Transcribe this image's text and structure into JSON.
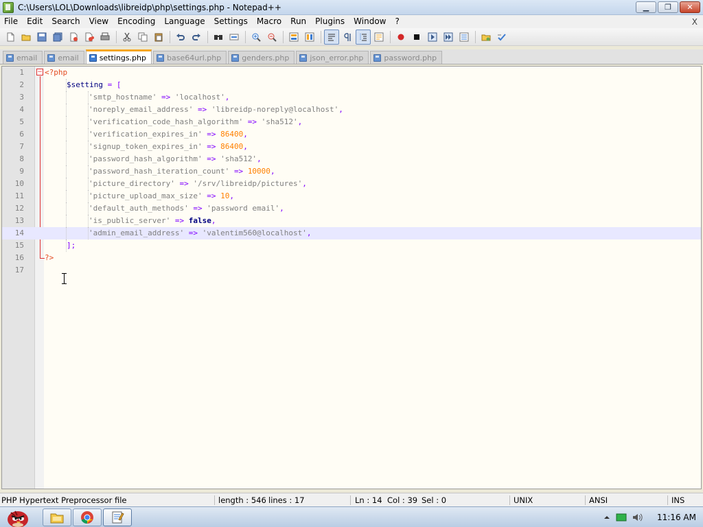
{
  "window": {
    "title": "C:\\Users\\LOL\\Downloads\\libreidp\\php\\settings.php - Notepad++",
    "minimize_glyph": "▁",
    "maximize_glyph": "❐",
    "close_glyph": "✕"
  },
  "menu": {
    "items": [
      "File",
      "Edit",
      "Search",
      "View",
      "Encoding",
      "Language",
      "Settings",
      "Macro",
      "Run",
      "Plugins",
      "Window",
      "?"
    ],
    "close_label": "X"
  },
  "toolbar": {
    "icons": [
      "new-file-icon",
      "open-file-icon",
      "save-icon",
      "save-all-icon",
      "close-icon",
      "close-all-icon",
      "print-icon",
      "cut-icon",
      "copy-icon",
      "paste-icon",
      "undo-icon",
      "redo-icon",
      "find-icon",
      "replace-icon",
      "zoom-in-icon",
      "zoom-out-icon",
      "sync-vertical-icon",
      "sync-horizontal-icon",
      "word-wrap-icon",
      "show-all-characters-icon",
      "indent-guide-icon",
      "function-list-icon",
      "record-macro-icon",
      "stop-macro-icon",
      "play-macro-icon",
      "run-macro-multiple-icon",
      "save-macro-icon",
      "folder-icon",
      "spellcheck-icon"
    ]
  },
  "tabs": [
    {
      "label": "email",
      "active": false
    },
    {
      "label": "email",
      "active": false
    },
    {
      "label": "settings.php",
      "active": true
    },
    {
      "label": "base64url.php",
      "active": false
    },
    {
      "label": "genders.php",
      "active": false
    },
    {
      "label": "json_error.php",
      "active": false
    },
    {
      "label": "password.php",
      "active": false
    }
  ],
  "editor": {
    "current_line": 14,
    "lines": [
      {
        "n": "1",
        "indent": 0,
        "tokens": [
          {
            "t": "<?php",
            "c": "php"
          }
        ]
      },
      {
        "n": "2",
        "indent": 1,
        "tokens": [
          {
            "t": "$setting",
            "c": "var"
          },
          {
            "t": " ",
            "c": ""
          },
          {
            "t": "=",
            "c": "op"
          },
          {
            "t": " ",
            "c": ""
          },
          {
            "t": "[",
            "c": "op"
          }
        ]
      },
      {
        "n": "3",
        "indent": 2,
        "tokens": [
          {
            "t": "'smtp_hostname'",
            "c": "str"
          },
          {
            "t": " ",
            "c": ""
          },
          {
            "t": "=>",
            "c": "op"
          },
          {
            "t": " ",
            "c": ""
          },
          {
            "t": "'localhost'",
            "c": "str"
          },
          {
            "t": ",",
            "c": "op"
          }
        ]
      },
      {
        "n": "4",
        "indent": 2,
        "tokens": [
          {
            "t": "'noreply_email_address'",
            "c": "str"
          },
          {
            "t": " ",
            "c": ""
          },
          {
            "t": "=>",
            "c": "op"
          },
          {
            "t": " ",
            "c": ""
          },
          {
            "t": "'libreidp-noreply@localhost'",
            "c": "str"
          },
          {
            "t": ",",
            "c": "op"
          }
        ]
      },
      {
        "n": "5",
        "indent": 2,
        "tokens": [
          {
            "t": "'verification_code_hash_algorithm'",
            "c": "str"
          },
          {
            "t": " ",
            "c": ""
          },
          {
            "t": "=>",
            "c": "op"
          },
          {
            "t": " ",
            "c": ""
          },
          {
            "t": "'sha512'",
            "c": "str"
          },
          {
            "t": ",",
            "c": "op"
          }
        ]
      },
      {
        "n": "6",
        "indent": 2,
        "tokens": [
          {
            "t": "'verification_expires_in'",
            "c": "str"
          },
          {
            "t": " ",
            "c": ""
          },
          {
            "t": "=>",
            "c": "op"
          },
          {
            "t": " ",
            "c": ""
          },
          {
            "t": "86400",
            "c": "num"
          },
          {
            "t": ",",
            "c": "op"
          }
        ]
      },
      {
        "n": "7",
        "indent": 2,
        "tokens": [
          {
            "t": "'signup_token_expires_in'",
            "c": "str"
          },
          {
            "t": " ",
            "c": ""
          },
          {
            "t": "=>",
            "c": "op"
          },
          {
            "t": " ",
            "c": ""
          },
          {
            "t": "86400",
            "c": "num"
          },
          {
            "t": ",",
            "c": "op"
          }
        ]
      },
      {
        "n": "8",
        "indent": 2,
        "tokens": [
          {
            "t": "'password_hash_algorithm'",
            "c": "str"
          },
          {
            "t": " ",
            "c": ""
          },
          {
            "t": "=>",
            "c": "op"
          },
          {
            "t": " ",
            "c": ""
          },
          {
            "t": "'sha512'",
            "c": "str"
          },
          {
            "t": ",",
            "c": "op"
          }
        ]
      },
      {
        "n": "9",
        "indent": 2,
        "tokens": [
          {
            "t": "'password_hash_iteration_count'",
            "c": "str"
          },
          {
            "t": " ",
            "c": ""
          },
          {
            "t": "=>",
            "c": "op"
          },
          {
            "t": " ",
            "c": ""
          },
          {
            "t": "10000",
            "c": "num"
          },
          {
            "t": ",",
            "c": "op"
          }
        ]
      },
      {
        "n": "10",
        "indent": 2,
        "tokens": [
          {
            "t": "'picture_directory'",
            "c": "str"
          },
          {
            "t": " ",
            "c": ""
          },
          {
            "t": "=>",
            "c": "op"
          },
          {
            "t": " ",
            "c": ""
          },
          {
            "t": "'/srv/libreidp/pictures'",
            "c": "str"
          },
          {
            "t": ",",
            "c": "op"
          }
        ]
      },
      {
        "n": "11",
        "indent": 2,
        "tokens": [
          {
            "t": "'picture_upload_max_size'",
            "c": "str"
          },
          {
            "t": " ",
            "c": ""
          },
          {
            "t": "=>",
            "c": "op"
          },
          {
            "t": " ",
            "c": ""
          },
          {
            "t": "10",
            "c": "num"
          },
          {
            "t": ",",
            "c": "op"
          }
        ]
      },
      {
        "n": "12",
        "indent": 2,
        "tokens": [
          {
            "t": "'default_auth_methods'",
            "c": "str"
          },
          {
            "t": " ",
            "c": ""
          },
          {
            "t": "=>",
            "c": "op"
          },
          {
            "t": " ",
            "c": ""
          },
          {
            "t": "'password email'",
            "c": "str"
          },
          {
            "t": ",",
            "c": "op"
          }
        ]
      },
      {
        "n": "13",
        "indent": 2,
        "tokens": [
          {
            "t": "'is_public_server'",
            "c": "str"
          },
          {
            "t": " ",
            "c": ""
          },
          {
            "t": "=>",
            "c": "op"
          },
          {
            "t": " ",
            "c": ""
          },
          {
            "t": "false",
            "c": "kw"
          },
          {
            "t": ",",
            "c": "op"
          }
        ]
      },
      {
        "n": "14",
        "indent": 2,
        "tokens": [
          {
            "t": "'admin_email_address'",
            "c": "str"
          },
          {
            "t": " ",
            "c": ""
          },
          {
            "t": "=>",
            "c": "op"
          },
          {
            "t": " ",
            "c": ""
          },
          {
            "t": "'valentim560@localhost'",
            "c": "str"
          },
          {
            "t": ",",
            "c": "op"
          }
        ]
      },
      {
        "n": "15",
        "indent": 1,
        "tokens": [
          {
            "t": "];",
            "c": "op"
          }
        ]
      },
      {
        "n": "16",
        "indent": 0,
        "tokens": [
          {
            "t": "?>",
            "c": "php"
          }
        ]
      },
      {
        "n": "17",
        "indent": 0,
        "tokens": []
      }
    ]
  },
  "statusbar": {
    "file_type": "PHP Hypertext Preprocessor file",
    "length": "length : 546",
    "lines": "lines : 17",
    "ln": "Ln : 14",
    "col": "Col : 39",
    "sel": "Sel : 0",
    "eol": "UNIX",
    "encoding": "ANSI",
    "mode": "INS"
  },
  "taskbar": {
    "time": "11:16 AM"
  },
  "colors": {
    "php_tag": "#e34c22",
    "variable": "#000080",
    "operator": "#8000ff",
    "string": "#808080",
    "number": "#ff8000",
    "current_line": "#e8e8ff",
    "fold_marker": "#e03030"
  }
}
